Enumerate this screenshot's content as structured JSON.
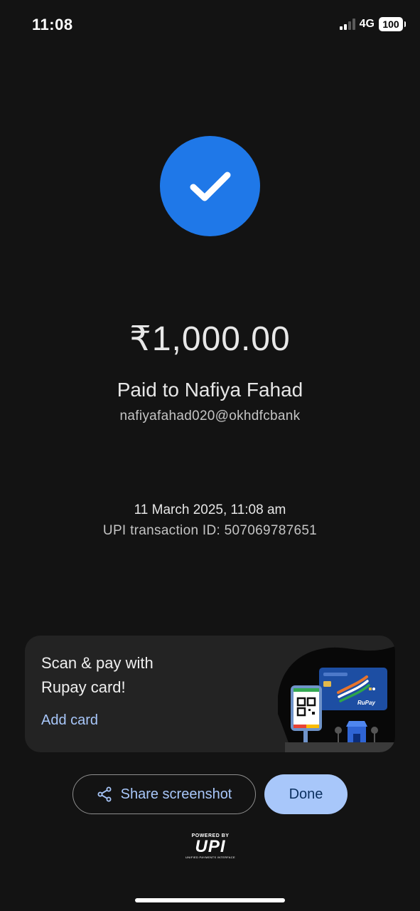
{
  "status_bar": {
    "time": "11:08",
    "network": "4G",
    "battery": "100"
  },
  "payment": {
    "amount": "₹1,000.00",
    "paid_to": "Paid to Nafiya Fahad",
    "upi_id": "nafiyafahad020@okhdfcbank",
    "date_time": "11 March 2025, 11:08 am",
    "transaction_id": "UPI transaction ID: 507069787651"
  },
  "promo": {
    "title": "Scan & pay with Rupay card!",
    "link_label": "Add card",
    "card_brand": "RuPay"
  },
  "actions": {
    "share_label": "Share screenshot",
    "done_label": "Done"
  },
  "footer": {
    "powered_by": "POWERED BY",
    "upi_mark": "UPI",
    "upi_subtitle": "UNIFIED PAYMENTS INTERFACE"
  },
  "icons": {
    "success": "check-icon",
    "share": "share-icon",
    "signal": "signal-icon",
    "battery": "battery-icon"
  },
  "colors": {
    "background": "#131313",
    "success_blue": "#1f78e8",
    "accent_light_blue": "#a8c7fa",
    "card_bg": "#232323"
  }
}
